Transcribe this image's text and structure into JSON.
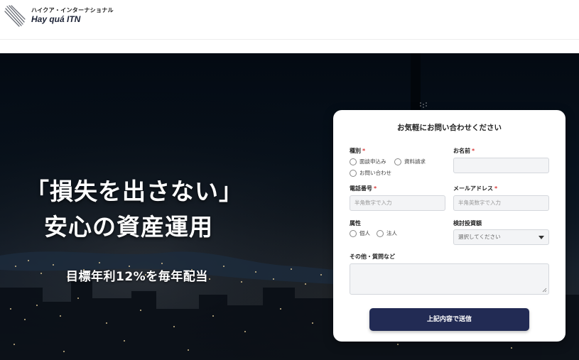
{
  "header": {
    "logo_jp": "ハイクア・インターナショナル",
    "logo_en": "Hay quá ITN"
  },
  "hero": {
    "headline_line1": "「損失を出さない」",
    "headline_line2": "安心の資産運用",
    "subline": "目標年利12%を毎年配当"
  },
  "form": {
    "title": "お気軽にお問い合わせください",
    "required_mark": "*",
    "type": {
      "label": "種別",
      "options": [
        "面談申込み",
        "資料請求",
        "お問い合わせ"
      ]
    },
    "name": {
      "label": "お名前",
      "placeholder": ""
    },
    "phone": {
      "label": "電話番号",
      "placeholder": "半角数字で入力"
    },
    "email": {
      "label": "メールアドレス",
      "placeholder": "半角英数字で入力"
    },
    "attribute": {
      "label": "属性",
      "options": [
        "個人",
        "法人"
      ]
    },
    "investment": {
      "label": "検討投資額",
      "selected": "選択してください"
    },
    "other": {
      "label": "その他・質問など"
    },
    "submit_label": "上記内容で送信"
  },
  "colors": {
    "accent": "#222b54",
    "required": "#d93a3a",
    "hero_dark": "#07111c"
  }
}
